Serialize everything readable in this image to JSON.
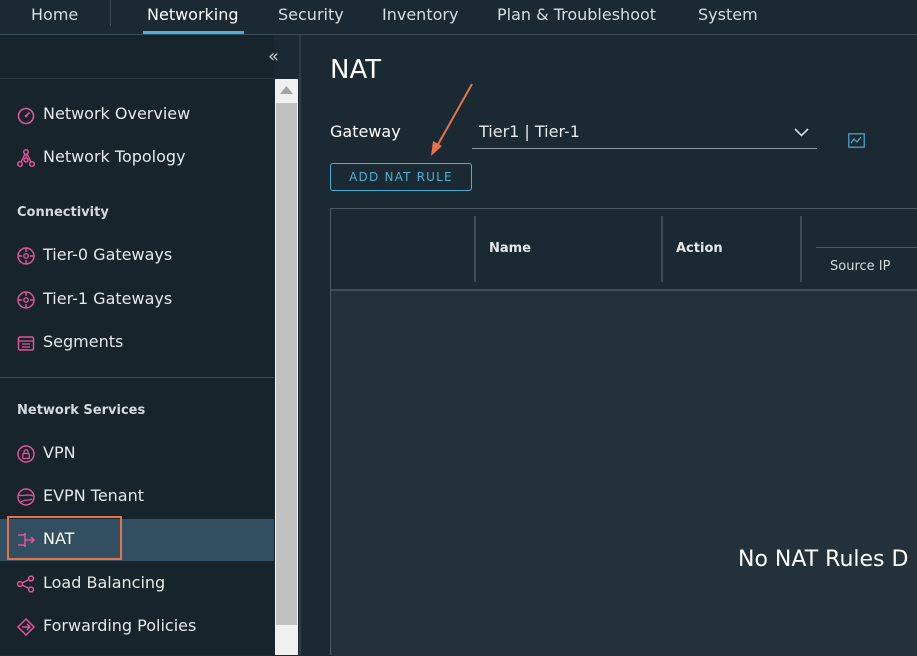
{
  "topnav": {
    "tabs": [
      {
        "label": "Home"
      },
      {
        "label": "Networking"
      },
      {
        "label": "Security"
      },
      {
        "label": "Inventory"
      },
      {
        "label": "Plan & Troubleshoot"
      },
      {
        "label": "System"
      }
    ],
    "active": "Networking"
  },
  "sidebar": {
    "collapse_glyph": "«",
    "items": [
      {
        "label": "Network Overview",
        "icon": "gauge-icon"
      },
      {
        "label": "Network Topology",
        "icon": "topology-icon"
      },
      {
        "label": "Tier-0 Gateways",
        "icon": "gateway-icon"
      },
      {
        "label": "Tier-1 Gateways",
        "icon": "gateway-icon"
      },
      {
        "label": "Segments",
        "icon": "segments-icon"
      },
      {
        "label": "VPN",
        "icon": "vpn-lock-icon"
      },
      {
        "label": "EVPN Tenant",
        "icon": "globe-icon"
      },
      {
        "label": "NAT",
        "icon": "nat-icon"
      },
      {
        "label": "Load Balancing",
        "icon": "share-icon"
      },
      {
        "label": "Forwarding Policies",
        "icon": "forwarding-icon"
      }
    ],
    "sections": {
      "connectivity": "Connectivity",
      "network_services": "Network Services"
    },
    "selected": "NAT"
  },
  "main": {
    "title": "NAT",
    "gateway_label": "Gateway",
    "gateway_value": "Tier1 | Tier-1",
    "add_button": "ADD NAT RULE",
    "columns": {
      "name": "Name",
      "action": "Action",
      "source_ip": "Source IP"
    },
    "empty_message": "No NAT Rules D"
  },
  "colors": {
    "accent": "#49afd9",
    "icon_pink": "#e2539a",
    "annotation": "#e6714a",
    "selected_bg": "#324f61"
  }
}
